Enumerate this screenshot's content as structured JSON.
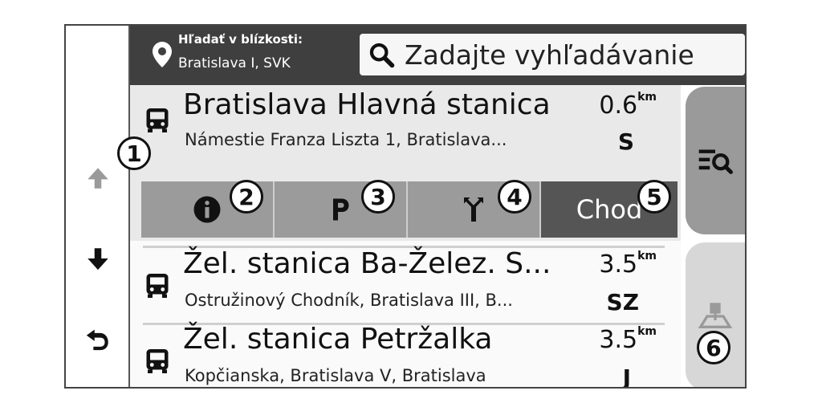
{
  "header": {
    "search_near_label": "Hľadať v blízkosti:",
    "search_near_value": "Bratislava I, SVK",
    "search_placeholder": "Zadajte vyhľadávanie"
  },
  "left_rail": {
    "icons": [
      "arrow-up-icon",
      "arrow-down-icon",
      "back-icon"
    ]
  },
  "results": [
    {
      "title": "Bratislava Hlavná stanica",
      "address": "Námestie Franza Liszta 1, Bratislava...",
      "distance": "0.6",
      "unit": "km",
      "direction": "S",
      "icon": "bus-icon"
    },
    {
      "title": "Žel. stanica Ba-Želez. S...",
      "address": "Ostružinový Chodník, Bratislava III, B...",
      "distance": "3.5",
      "unit": "km",
      "direction": "SZ",
      "icon": "bus-icon"
    },
    {
      "title": "Žel. stanica Petržalka",
      "address": "Kopčianska, Bratislava V, Bratislava",
      "distance": "3.5",
      "unit": "km",
      "direction": "J",
      "icon": "bus-icon"
    }
  ],
  "actions": {
    "info_icon": "info-icon",
    "parking_icon": "parking-icon",
    "route_icon": "route-fork-icon",
    "go_label": "Choď"
  },
  "tabs": {
    "list_icon": "list-search-icon",
    "map_icon": "map-pin-icon"
  },
  "callouts": [
    "1",
    "2",
    "3",
    "4",
    "5",
    "6"
  ],
  "colors": {
    "header_bg": "#3f3f3f",
    "action_bg": "#9b9b9b",
    "go_bg": "#555555",
    "tab_active": "#9a9a9a"
  }
}
